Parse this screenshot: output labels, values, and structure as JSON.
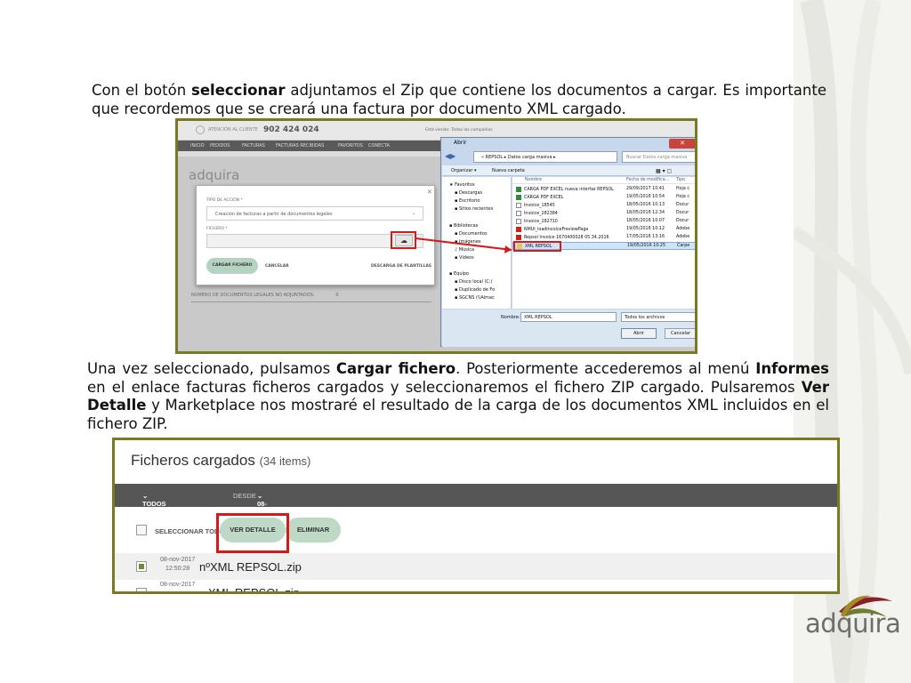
{
  "paragraph1": {
    "t1": "Con el botón ",
    "b1": "seleccionar",
    "t2": " adjuntamos el Zip que contiene los documentos a cargar. Es importante que recordemos que se creará una factura por documento XML cargado."
  },
  "paragraph2": {
    "t1": "Una vez seleccionado, pulsamos ",
    "b1": "Cargar fichero",
    "t2": ". Posteriormente  accederemos al menú ",
    "b2": "Informes",
    "t3": " en el enlace facturas ficheros cargados y seleccionaremos el fichero ZIP cargado. Pulsaremos ",
    "b3": "Ver Detalle",
    "t4": " y Marketplace nos mostraré el resultado de la carga de los documentos XML incluidos en el fichero ZIP."
  },
  "screenshot1": {
    "topbar": {
      "attention": "ATENCIÓN AL CLIENTE",
      "phone": "902 424 024",
      "viewing": "Está viendo: Todas las compañías",
      "connected": "Conectado como: [h_repsol]"
    },
    "nav": [
      "INICIO",
      "PEDIDOS",
      "FACTURAS",
      "FACTURAS RECIBIDAS",
      "FAVORITOS",
      "CONECTA"
    ],
    "logo": "adquira",
    "modal": {
      "action_label": "TIPO DE ACCIÓN *",
      "action_value": "Creacion de facturas a partir de documentos legales",
      "file_label": "FICHERO *",
      "upload_icon": "cloud-upload-icon",
      "load_button": "CARGAR FICHERO",
      "cancel": "CANCELAR",
      "templates": "DESCARGA DE PLANTILLAS"
    },
    "docs_label": "NUMERO DE DOCUMENTOS LEGALES NO ADJUNTADOS:",
    "docs_value": "0",
    "dialog": {
      "title": "Abrir",
      "address": "« REPSOL ▸ Datos carga masiva ▸",
      "search_placeholder": "Buscar Datos carga masiva",
      "organize": "Organizar ▾",
      "new_folder": "Nueva carpeta",
      "nav": [
        "Favoritos",
        "Descargas",
        "Escritorio",
        "Sitios recientes",
        "Bibliotecas",
        "Documentos",
        "Imágenes",
        "Música",
        "Vídeos",
        "Equipo",
        "Disco local (C:)",
        "Duplicado de Fo",
        "SGCNS (\\\\Almac"
      ],
      "columns": [
        "Nombre",
        "Fecha de modifica...",
        "Tipo"
      ],
      "files": [
        {
          "name": "CARGA PDF EXCEL nueva interfaz REPSOL",
          "date": "29/09/2017 10:41",
          "type": "Hoja c"
        },
        {
          "name": "CARGA PDF EXCEL",
          "date": "19/05/2016 10:54",
          "type": "Hoja c"
        },
        {
          "name": "Invoice_18545",
          "date": "18/05/2016 10:13",
          "type": "Docur"
        },
        {
          "name": "Invoice_282384",
          "date": "18/05/2016 12:34",
          "type": "Docur"
        },
        {
          "name": "Invoice_282710",
          "date": "18/05/2016 10:07",
          "type": "Docur"
        },
        {
          "name": "NMUI_loadInvoiceFreviewPage",
          "date": "19/05/2016 10:12",
          "type": "Adobe"
        },
        {
          "name": "Repsol Invoice 1670400028 05.34.2016",
          "date": "17/05/2016 13:16",
          "type": "Adobe"
        },
        {
          "name": "XML REPSOL",
          "date": "19/05/2016 10:25",
          "type": "Carpe"
        }
      ],
      "filename_label": "Nombre:",
      "filename_value": "XML REPSOL",
      "filter": "Todos los archivos",
      "open": "Abrir",
      "cancel": "Cancelar"
    }
  },
  "screenshot2": {
    "title": "Ficheros cargados",
    "count": "(34 items)",
    "filter_all": "TODOS LOS FICHEROS",
    "since_label": "DESDE",
    "since_value": "08-MAY-2017",
    "select_all": "SELECCIONAR TODO",
    "view_detail": "VER DETALLE",
    "delete": "ELIMINAR",
    "rows": [
      {
        "date": "08-nov-2017",
        "time": "12:50:28",
        "name": "nºXML REPSOL.zip"
      },
      {
        "date": "08-nov-2017",
        "time": "",
        "name": "XML REPSOL.zip"
      }
    ]
  },
  "brand": "adquira",
  "colors": {
    "frame": "#7a7a22",
    "highlight": "#d61a1a",
    "green_button": "#bfd9c7",
    "bar": "#565656"
  }
}
